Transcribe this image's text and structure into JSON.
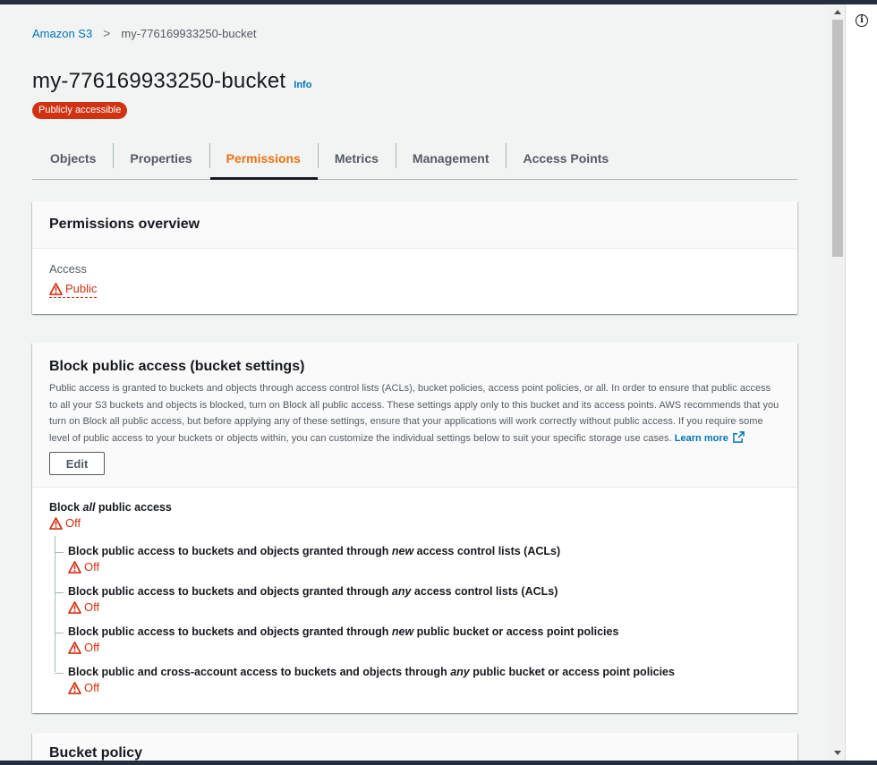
{
  "breadcrumb": {
    "root": "Amazon S3",
    "separator": ">",
    "current": "my-776169933250-bucket"
  },
  "page": {
    "title": "my-776169933250-bucket",
    "info_label": "Info",
    "badge": "Publicly accessible"
  },
  "tabs": [
    {
      "label": "Objects",
      "active": false
    },
    {
      "label": "Properties",
      "active": false
    },
    {
      "label": "Permissions",
      "active": true
    },
    {
      "label": "Metrics",
      "active": false
    },
    {
      "label": "Management",
      "active": false
    },
    {
      "label": "Access Points",
      "active": false
    }
  ],
  "overview": {
    "title": "Permissions overview",
    "access_label": "Access",
    "access_value": "Public"
  },
  "block_public_access": {
    "title": "Block public access (bucket settings)",
    "description": "Public access is granted to buckets and objects through access control lists (ACLs), bucket policies, access point policies, or all. In order to ensure that public access to all your S3 buckets and objects is blocked, turn on Block all public access. These settings apply only to this bucket and its access points. AWS recommends that you turn on Block all public access, but before applying any of these settings, ensure that your applications will work correctly without public access. If you require some level of public access to your buckets or objects within, you can customize the individual settings below to suit your specific storage use cases.",
    "learn_more": "Learn more",
    "edit_label": "Edit",
    "all": {
      "pre": "Block ",
      "em": "all",
      "post": " public access",
      "status": "Off"
    },
    "settings": [
      {
        "pre": "Block public access to buckets and objects granted through ",
        "em": "new",
        "post": " access control lists (ACLs)",
        "status": "Off"
      },
      {
        "pre": "Block public access to buckets and objects granted through ",
        "em": "any",
        "post": " access control lists (ACLs)",
        "status": "Off"
      },
      {
        "pre": "Block public access to buckets and objects granted through ",
        "em": "new",
        "post": " public bucket or access point policies",
        "status": "Off"
      },
      {
        "pre": "Block public and cross-account access to buckets and objects through ",
        "em": "any",
        "post": " public bucket or access point policies",
        "status": "Off"
      }
    ]
  },
  "bucket_policy": {
    "title": "Bucket policy"
  },
  "colors": {
    "link": "#0073bb",
    "warning": "#d13212",
    "active_tab": "#ec7211"
  },
  "icons": {
    "warning": "warning-triangle-icon",
    "external": "external-link-icon",
    "info": "info-circle-icon"
  }
}
